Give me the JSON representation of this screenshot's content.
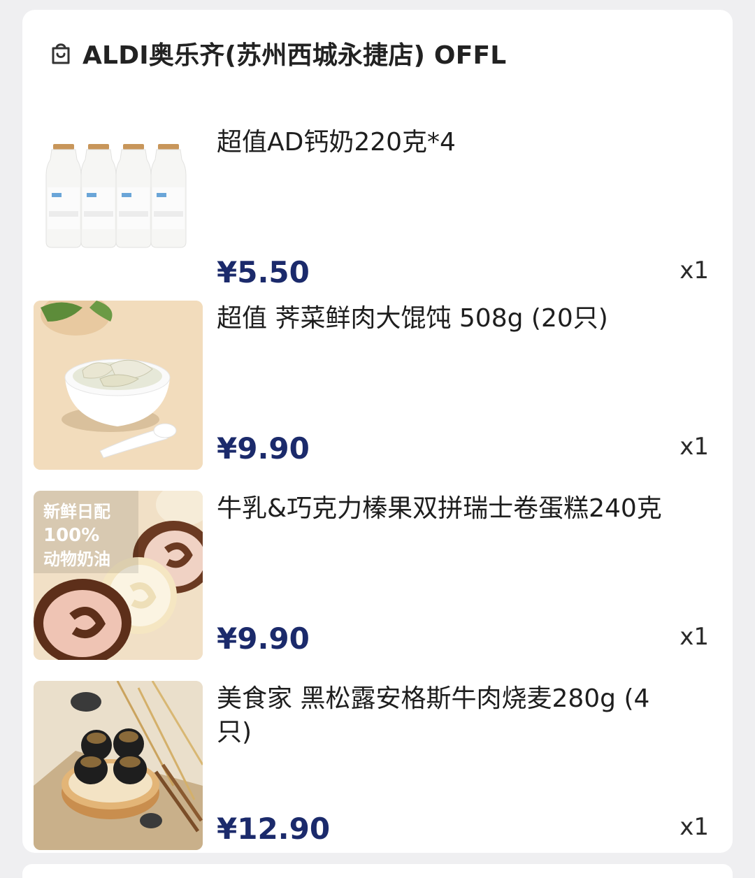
{
  "store": {
    "icon": "shopping-bag-icon",
    "name": "ALDI奥乐齐(苏州西城永捷店) OFFL"
  },
  "items": [
    {
      "title": "超值AD钙奶220克*4",
      "price": "¥5.50",
      "qty": "x1",
      "image": "milk-bottles-image"
    },
    {
      "title": "超值 荠菜鲜肉大馄饨 508g (20只)",
      "price": "¥9.90",
      "qty": "x1",
      "image": "wonton-bowl-image"
    },
    {
      "title": "牛乳&巧克力榛果双拼瑞士卷蛋糕240克",
      "price": "¥9.90",
      "qty": "x1",
      "image": "swiss-roll-image",
      "badge": [
        "新鲜日配",
        "100%",
        "动物奶油"
      ]
    },
    {
      "title": "美食家 黑松露安格斯牛肉烧麦280g (4只)",
      "price": "¥12.90",
      "qty": "x1",
      "image": "shumai-image"
    }
  ],
  "colors": {
    "price": "#1b2a6b",
    "background": "#efeff1",
    "card": "#ffffff"
  }
}
